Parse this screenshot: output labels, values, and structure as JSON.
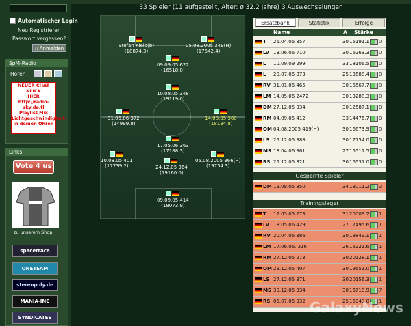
{
  "sidebar": {
    "auto_login_label": "Automatischer Login",
    "register_link": "Neu Registrieren",
    "forgot_link": "Passwort vergessen?",
    "login_button": ":: Anmelden",
    "radio_title": "SpM-Radio",
    "radio_listen": "Hören",
    "radio_ad_lines": [
      "NEUER CHAT KLICK",
      "HIER",
      "http://radio-",
      "sky.de.tl",
      "Playlist Mix",
      "Lichtgeschwindigkeit,",
      "in deinen Ohren"
    ],
    "links_title": "Links",
    "vote_button": "Vote 4 us",
    "shop_text": "zu unserem Shop",
    "banners": [
      "spacetrace",
      "ONETEAM",
      "stereopoly.de",
      "MANIA-INC",
      "SYNDICATES"
    ]
  },
  "summary": {
    "text": "33 Spieler   (11 aufgestellt, Alter: ø 32.2 Jahre)   3 Auswechselungen"
  },
  "field_players": [
    {
      "name": "Stefan Kleib(b)",
      "strength": "(18874.3)"
    },
    {
      "name": "05.08.2005 349(H)",
      "strength": "(17542.4)"
    },
    {
      "name": "09.09.05 622",
      "strength": "(16518.0)"
    },
    {
      "name": "10.08.05 348",
      "strength": "(19119.0)"
    },
    {
      "name": "31.05.06 372",
      "strength": "(14999.8)"
    },
    {
      "name": "14.08.05 360",
      "strength": "(18134.8)"
    },
    {
      "name": "17.05.06 363",
      "strength": "(17188.3)"
    },
    {
      "name": "10.08.05 401",
      "strength": "(17739.2)"
    },
    {
      "name": "24.12.05 364",
      "strength": "(19160.0)"
    },
    {
      "name": "05.08.2005 366(H)",
      "strength": "(19754.3)"
    },
    {
      "name": "09.09.05 414",
      "strength": "(18073.9)"
    }
  ],
  "table": {
    "tabs": [
      "Ersatzbank",
      "Statistik",
      "Erfolge"
    ],
    "headers": {
      "name": "Name",
      "age": "A",
      "strength": "Stärke"
    },
    "bench": [
      {
        "pos": "T",
        "name": "26.04.06 857",
        "age": "30",
        "strength": "15191.1",
        "count": "0"
      },
      {
        "pos": "LV",
        "name": "13.06.06 710",
        "age": "30",
        "strength": "16263.3",
        "count": "0"
      },
      {
        "pos": "L",
        "name": "10.09.09 299",
        "age": "33",
        "strength": "18106.5",
        "count": "0"
      },
      {
        "pos": "L",
        "name": "20.07.06 373",
        "age": "25",
        "strength": "13588.4",
        "count": "0"
      },
      {
        "pos": "RV",
        "name": "31.01.06 465",
        "age": "30",
        "strength": "16567.7",
        "count": "0"
      },
      {
        "pos": "LM",
        "name": "14.05.06 2472",
        "age": "30",
        "strength": "13288.3",
        "count": "0"
      },
      {
        "pos": "DM",
        "name": "27.12.05 334",
        "age": "30",
        "strength": "12587.1",
        "count": "0"
      },
      {
        "pos": "RM",
        "name": "04.09.05 412",
        "age": "33",
        "strength": "14476.7",
        "count": "0"
      },
      {
        "pos": "OM",
        "name": "04.08.2005 419(H)",
        "age": "30",
        "strength": "16673.9",
        "count": "0"
      },
      {
        "pos": "LS",
        "name": "25.12.05 388",
        "age": "30",
        "strength": "17154.0",
        "count": "0"
      },
      {
        "pos": "MS",
        "name": "18.04.06 361",
        "age": "27",
        "strength": "15511.5",
        "count": "0"
      },
      {
        "pos": "RS",
        "name": "25.12.05 321",
        "age": "30",
        "strength": "16531.0",
        "count": "0"
      }
    ],
    "blocked_title": "Gesperrte Spieler",
    "blocked": [
      {
        "pos": "DM",
        "name": "19.08.05 350",
        "age": "34",
        "strength": "18011.2",
        "count": "2"
      }
    ],
    "camp_title": "Trainingslager",
    "camp": [
      {
        "pos": "T",
        "name": "12.05.05 273",
        "age": "31",
        "strength": "20009.2",
        "count": "1"
      },
      {
        "pos": "LV",
        "name": "18.05.06 429",
        "age": "27",
        "strength": "17495.6",
        "count": "1"
      },
      {
        "pos": "RV",
        "name": "20.04.06 386",
        "age": "30",
        "strength": "18849.1",
        "count": "1"
      },
      {
        "pos": "LM",
        "name": "17.06.06. 316",
        "age": "26",
        "strength": "16221.6",
        "count": "1"
      },
      {
        "pos": "RM",
        "name": "27.12.05 273",
        "age": "30",
        "strength": "20128.1",
        "count": "1"
      },
      {
        "pos": "OM",
        "name": "29.12.05 407",
        "age": "30",
        "strength": "19651.0",
        "count": "1"
      },
      {
        "pos": "LS",
        "name": "27.12.05 371",
        "age": "30",
        "strength": "20156.3",
        "count": "1"
      },
      {
        "pos": "MS",
        "name": "30.12.05 334",
        "age": "30",
        "strength": "16718.9",
        "count": "7"
      },
      {
        "pos": "RS",
        "name": "05.07.06 332",
        "age": "25",
        "strength": "15049.0",
        "count": "1"
      }
    ]
  },
  "watermark": "GalaxyNews"
}
